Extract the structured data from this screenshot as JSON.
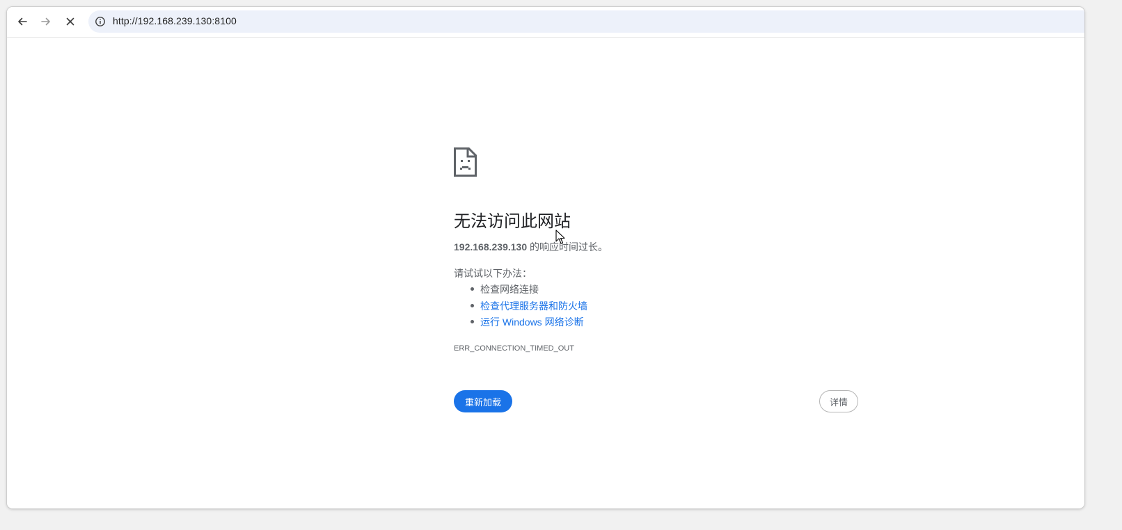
{
  "browser": {
    "url": "http://192.168.239.130:8100",
    "icons": {
      "back": "arrow-left-icon",
      "forward": "arrow-right-icon",
      "stop": "close-icon",
      "site_info": "info-icon"
    }
  },
  "error_page": {
    "icon": "sad-page-icon",
    "title": "无法访问此网站",
    "host": "192.168.239.130",
    "description_suffix": " 的响应时间过长。",
    "suggestions_title": "请试试以下办法：",
    "suggestions": [
      {
        "label": "检查网络连接",
        "is_link": false
      },
      {
        "label": "检查代理服务器和防火墙",
        "is_link": true
      },
      {
        "label": "运行 Windows 网络诊断",
        "is_link": true
      }
    ],
    "error_code": "ERR_CONNECTION_TIMED_OUT",
    "reload_label": "重新加载",
    "details_label": "详情"
  },
  "colors": {
    "accent": "#1a73e8",
    "text": "#5f6368",
    "title": "#202124",
    "omnibox_bg": "#edf1fa"
  }
}
